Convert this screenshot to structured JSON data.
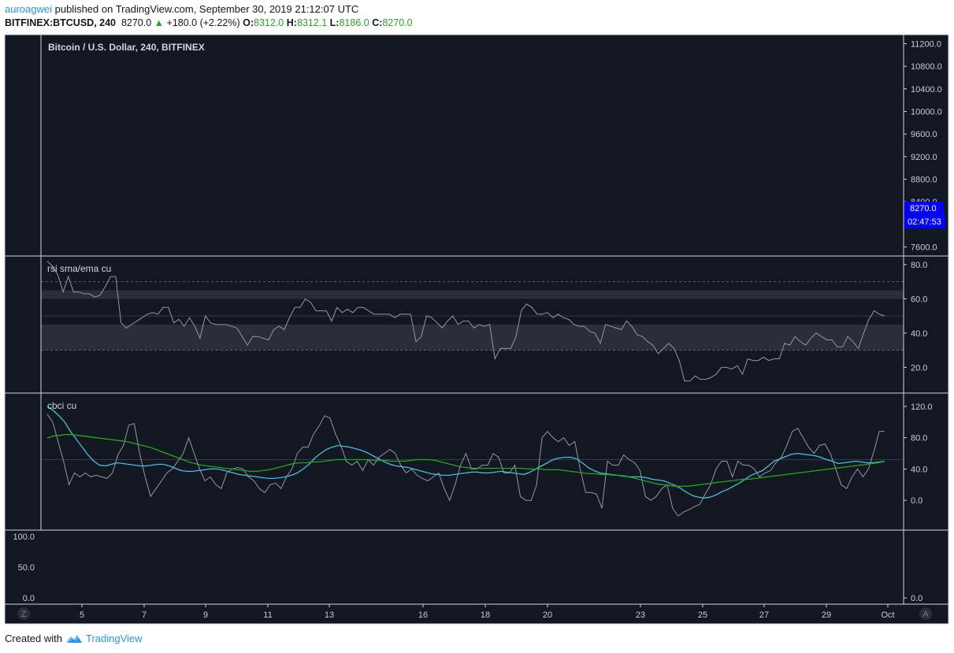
{
  "header": {
    "author": "auroagwei",
    "published_text": " published on TradingView.com, September 30, 2019 21:12:07 UTC",
    "symbol": "BITFINEX:BTCUSD, 240",
    "last": "8270.0",
    "change_arrow": "▲",
    "change": "+180.0 (+2.22%)",
    "o_label": "O:",
    "o_val": "8312.0",
    "h_label": "H:",
    "h_val": "8312.1",
    "l_label": "L:",
    "l_val": "8186.0",
    "c_label": "C:",
    "c_val": "8270.0"
  },
  "footer": {
    "created_with": "Created with",
    "brand": "TradingView"
  },
  "colors": {
    "background": "#131722",
    "border": "#d1d4dc",
    "white_line": "#9598a1",
    "cyan": "#3fc1e0",
    "green": "#26a620",
    "price_tag": "#0000ff"
  },
  "chart_data": [
    {
      "type": "line",
      "title": "Bitcoin / U.S. Dollar, 240, BITFINEX",
      "y_ticks": [
        "11200.0",
        "10800.0",
        "10400.0",
        "10000.0",
        "9600.0",
        "9200.0",
        "8800.0",
        "8400.0",
        "7600.0"
      ],
      "ylim": [
        7440,
        11360
      ],
      "price_tag": "8270.0",
      "countdown_tag": "02:47:53",
      "series": []
    },
    {
      "type": "line",
      "title": "rsi sma/ema cu",
      "y_ticks": [
        "80.0",
        "60.0",
        "40.0",
        "20.0"
      ],
      "ylim": [
        5,
        85
      ],
      "levels": {
        "upper_dashed": 70,
        "upper_band": [
          60,
          65
        ],
        "mid": 50,
        "lower_band": [
          30,
          45
        ],
        "lower_dashed": 30
      },
      "series": [
        {
          "values": [
            82,
            79,
            74,
            64,
            73,
            64,
            64,
            63,
            63,
            61,
            62,
            67,
            73,
            73,
            46,
            43,
            45,
            47,
            49,
            51,
            52,
            51,
            55,
            55,
            46,
            48,
            44,
            49,
            44,
            37,
            50,
            46,
            45,
            45,
            45,
            44,
            43,
            38,
            33,
            38,
            38,
            37,
            36,
            42,
            44,
            42,
            49,
            55,
            55,
            60,
            58,
            53,
            53,
            53,
            47,
            55,
            52,
            54,
            52,
            55,
            55,
            53,
            51,
            51,
            51,
            51,
            49,
            51,
            51,
            51,
            35,
            38,
            50,
            49,
            46,
            43,
            47,
            50,
            45,
            47,
            47,
            43,
            45,
            44,
            45,
            25,
            31,
            31,
            31,
            38,
            53,
            57,
            55,
            51,
            51,
            52,
            49,
            51,
            49,
            48,
            45,
            44,
            44,
            41,
            40,
            34,
            45,
            44,
            43,
            42,
            47,
            44,
            39,
            38,
            35,
            33,
            28,
            31,
            34,
            31,
            24,
            12,
            12,
            15,
            13,
            13,
            14,
            16,
            20,
            20,
            19,
            21,
            16,
            25,
            24,
            24,
            26,
            24,
            25,
            25,
            34,
            33,
            38,
            35,
            33,
            37,
            40,
            38,
            36,
            36,
            32,
            32,
            38,
            35,
            31,
            40,
            48,
            53,
            51,
            50
          ]
        }
      ]
    },
    {
      "type": "line",
      "title": "cbci cu",
      "y_ticks": [
        "120.0",
        "80.0",
        "40.0",
        "0.0"
      ],
      "ylim": [
        -38,
        137
      ],
      "levels": {
        "mid": 52
      },
      "series": [
        {
          "color": "white",
          "values": [
            110,
            100,
            75,
            50,
            20,
            35,
            30,
            35,
            30,
            32,
            30,
            28,
            35,
            58,
            70,
            96,
            98,
            60,
            30,
            5,
            15,
            25,
            35,
            40,
            50,
            60,
            80,
            60,
            40,
            25,
            30,
            20,
            15,
            35,
            40,
            42,
            40,
            30,
            25,
            15,
            10,
            20,
            22,
            15,
            30,
            40,
            60,
            68,
            68,
            85,
            95,
            108,
            105,
            85,
            70,
            50,
            45,
            50,
            38,
            52,
            45,
            55,
            60,
            65,
            60,
            45,
            35,
            40,
            32,
            28,
            25,
            30,
            35,
            15,
            0,
            20,
            45,
            60,
            40,
            40,
            45,
            45,
            60,
            55,
            35,
            35,
            45,
            5,
            0,
            0,
            20,
            80,
            88,
            80,
            75,
            80,
            70,
            75,
            40,
            10,
            10,
            8,
            -10,
            50,
            45,
            45,
            58,
            52,
            48,
            38,
            5,
            0,
            5,
            15,
            20,
            -10,
            -20,
            -15,
            -12,
            -8,
            -5,
            8,
            20,
            40,
            50,
            50,
            30,
            50,
            45,
            45,
            40,
            30,
            35,
            38,
            48,
            55,
            70,
            88,
            92,
            80,
            68,
            60,
            70,
            72,
            60,
            40,
            20,
            15,
            30,
            40,
            30,
            40,
            62,
            88,
            88
          ]
        },
        {
          "color": "cyan",
          "values": [
            120,
            115,
            108,
            100,
            88,
            78,
            68,
            58,
            50,
            45,
            44,
            46,
            48,
            47,
            46,
            45,
            44,
            44,
            45,
            46,
            46,
            44,
            41,
            38,
            37,
            37,
            38,
            39,
            40,
            40,
            39,
            37,
            35,
            33,
            32,
            31,
            30,
            29,
            28,
            28,
            29,
            30,
            32,
            35,
            40,
            46,
            54,
            60,
            65,
            68,
            70,
            69,
            68,
            66,
            64,
            61,
            57,
            53,
            49,
            46,
            44,
            43,
            42,
            40,
            38,
            36,
            34,
            33,
            32,
            32,
            33,
            34,
            35,
            36,
            36,
            35,
            35,
            36,
            37,
            36,
            35,
            34,
            33,
            36,
            40,
            44,
            48,
            52,
            54,
            55,
            55,
            53,
            48,
            42,
            38,
            35,
            34,
            33,
            32,
            31,
            30,
            30,
            30,
            29,
            27,
            26,
            25,
            22,
            19,
            15,
            10,
            6,
            4,
            3,
            4,
            7,
            11,
            14,
            18,
            22,
            27,
            32,
            35,
            38,
            44,
            50,
            53,
            56,
            59,
            60,
            59,
            58,
            57,
            55,
            52,
            50,
            47,
            48,
            49,
            50,
            49,
            48,
            48,
            49,
            50
          ]
        },
        {
          "color": "green",
          "values": [
            80,
            82,
            83,
            84,
            84,
            83,
            82,
            81,
            80,
            79,
            78,
            77,
            76,
            75,
            73,
            71,
            69,
            67,
            64,
            61,
            58,
            55,
            52,
            49,
            47,
            45,
            44,
            43,
            42,
            41,
            40,
            39,
            38,
            37,
            37,
            38,
            39,
            41,
            43,
            45,
            47,
            48,
            48,
            49,
            49,
            50,
            51,
            52,
            52,
            52,
            52,
            52,
            52,
            51,
            51,
            51,
            50,
            50,
            50,
            51,
            52,
            52,
            52,
            51,
            49,
            47,
            45,
            43,
            42,
            41,
            41,
            41,
            41,
            41,
            41,
            41,
            41,
            41,
            40,
            40,
            40,
            39,
            39,
            39,
            38,
            37,
            36,
            35,
            34,
            34,
            33,
            33,
            32,
            32,
            31,
            29,
            27,
            25,
            23,
            21,
            20,
            19,
            18,
            18,
            18,
            19,
            20,
            21,
            22,
            23,
            24,
            25,
            26,
            27,
            27,
            28,
            29,
            30,
            31,
            32,
            33,
            34,
            35,
            36,
            37,
            38,
            39,
            40,
            41,
            42,
            43,
            44,
            45,
            46,
            47,
            48,
            50
          ]
        }
      ]
    },
    {
      "type": "line",
      "title": "",
      "y_ticks": [
        "100.0",
        "50.0",
        "0.0"
      ],
      "right_ticks": [
        "0.0"
      ],
      "ylim": [
        -10,
        110
      ],
      "series": []
    }
  ],
  "x_axis": {
    "labels": [
      "5",
      "7",
      "9",
      "11",
      "13",
      "16",
      "18",
      "20",
      "23",
      "25",
      "27",
      "29",
      "Oct"
    ],
    "left_button": "Z",
    "right_button": "A"
  }
}
